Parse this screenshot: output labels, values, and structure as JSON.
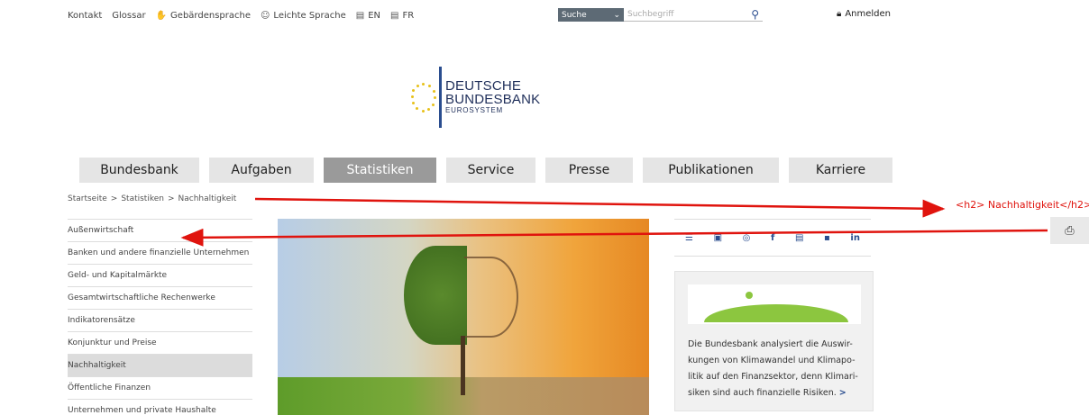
{
  "topbar": {
    "links": [
      {
        "label": "Kontakt",
        "icon": ""
      },
      {
        "label": "Glossar",
        "icon": ""
      },
      {
        "label": "Gebärdensprache",
        "icon": "sign-language-icon"
      },
      {
        "label": "Leichte Sprache",
        "icon": "easy-language-icon"
      },
      {
        "label": "EN",
        "icon": "language-icon"
      },
      {
        "label": "FR",
        "icon": "language-icon"
      }
    ],
    "search_select": "Suche",
    "search_placeholder": "Suchbegriff",
    "login_label": "Anmelden"
  },
  "logo": {
    "line1": "DEUTSCHE",
    "line2": "BUNDESBANK",
    "line3": "EUROSYSTEM"
  },
  "nav": {
    "items": [
      {
        "label": "Bundesbank",
        "active": false
      },
      {
        "label": "Aufgaben",
        "active": false
      },
      {
        "label": "Statistiken",
        "active": true
      },
      {
        "label": "Service",
        "active": false
      },
      {
        "label": "Presse",
        "active": false
      },
      {
        "label": "Publikationen",
        "active": false
      },
      {
        "label": "Karriere",
        "active": false
      }
    ]
  },
  "breadcrumb": [
    "Startseite",
    "Statistiken",
    "Nachhaltigkeit"
  ],
  "breadcrumb_sep": ">",
  "sidebar": {
    "items": [
      {
        "label": "Außenwirtschaft",
        "active": false
      },
      {
        "label": "Banken und andere finanzielle Unternehmen",
        "active": false
      },
      {
        "label": "Geld- und Kapitalmärkte",
        "active": false
      },
      {
        "label": "Gesamtwirtschaftliche Rechenwerke",
        "active": false
      },
      {
        "label": "Indikatorensätze",
        "active": false
      },
      {
        "label": "Konjunktur und Preise",
        "active": false
      },
      {
        "label": "Nachhaltigkeit",
        "active": true
      },
      {
        "label": "Öffentliche Finanzen",
        "active": false
      },
      {
        "label": "Unternehmen und private Haushalte",
        "active": false
      }
    ]
  },
  "share": [
    "list-icon",
    "twitter-icon",
    "instagram-icon",
    "facebook-icon",
    "youtube-icon",
    "mastodon-icon",
    "linkedin-icon"
  ],
  "teaser": {
    "text": "Die Bundesbank analysiert die Auswirkungen von Klimawandel und Klimapolitik auf den Finanzsektor, denn Klimarisiken sind auch finanzielle Risiken.",
    "line1": "Die Bundesbank analysiert die Auswir-",
    "line2": "kungen von Klimawandel und Klimapo-",
    "line3": "litik auf den Finanzsektor, denn Klimari-",
    "line4": "siken sind auch finanzielle Risiken.",
    "arrow": ">"
  },
  "annotation": "<h2> Nachhaltigkeit</h2>",
  "colors": {
    "accent": "#2a4d8f",
    "annotation_red": "#e0140e",
    "nav_active": "#9a9a9a",
    "logo_yellow": "#e7c11a"
  }
}
